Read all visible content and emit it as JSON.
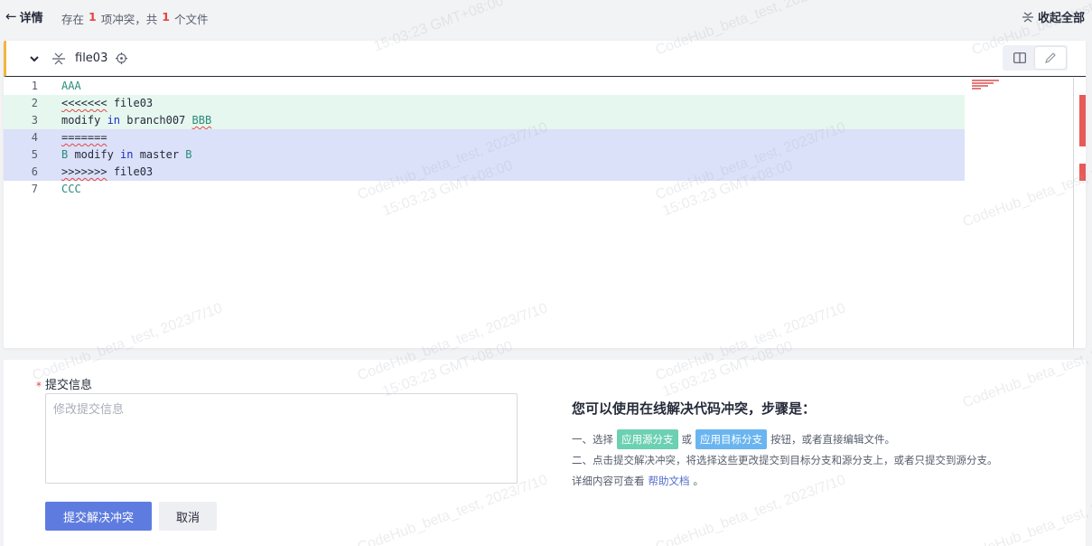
{
  "topbar": {
    "back_label": "详情",
    "summary_prefix": "存在",
    "conflict_count": "1",
    "summary_mid": "项冲突，共",
    "file_count": "1",
    "summary_suffix": "个文件",
    "collapse_all_label": "收起全部"
  },
  "file": {
    "name": "file03",
    "lines": [
      {
        "no": "1",
        "text": "AAA"
      },
      {
        "no": "2",
        "text": "<<<<<<< file03"
      },
      {
        "no": "3",
        "text": "modify in branch007 BBB"
      },
      {
        "no": "4",
        "text": "======="
      },
      {
        "no": "5",
        "text": "B modify in master B"
      },
      {
        "no": "6",
        "text": ">>>>>>> file03"
      },
      {
        "no": "7",
        "text": "CCC"
      }
    ]
  },
  "commit": {
    "label": "提交信息",
    "required_mark": "*",
    "placeholder": "修改提交信息",
    "submit_label": "提交解决冲突",
    "cancel_label": "取消"
  },
  "steps": {
    "title": "您可以使用在线解决代码冲突，步骤是：",
    "step1_prefix": "一、选择",
    "tag_source": "应用源分支",
    "or": "或",
    "tag_target": "应用目标分支",
    "step1_suffix": "按钮，或者直接编辑文件。",
    "step2": "二、点击提交解决冲突，将选择这些更改提交到目标分支和源分支上，或者只提交到源分支。",
    "step3_prefix": "详细内容可查看",
    "help_link": "帮助文档",
    "step3_suffix": "。"
  },
  "watermark": {
    "line1": "CodeHub_beta_test, 2023/7/10",
    "line2": "15:03:23 GMT+08:00"
  },
  "colors": {
    "accent": "#5e7ce0",
    "conflict_current_bg": "#e5f7ef",
    "conflict_incoming_bg": "#dbe1f8",
    "header_marker": "#f4b63f",
    "error_red": "#e54545"
  }
}
